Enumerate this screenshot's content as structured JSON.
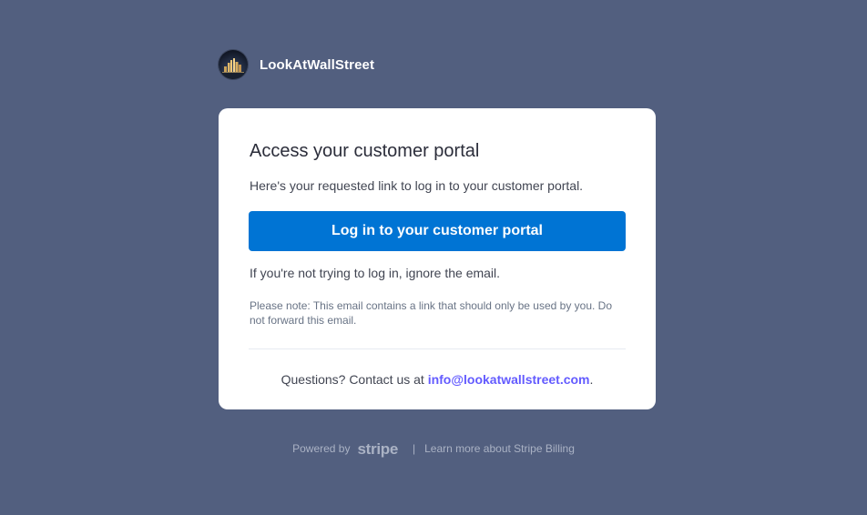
{
  "brand": {
    "name": "LookAtWallStreet",
    "avatar_icon": "city-skyline-icon"
  },
  "card": {
    "title": "Access your customer portal",
    "intro": "Here's your requested link to log in to your customer portal.",
    "login_button_label": "Log in to your customer portal",
    "ignore_text": "If you're not trying to log in, ignore the email.",
    "note": "Please note: This email contains a link that should only be used by you. Do not forward this email.",
    "contact_prefix": "Questions? Contact us at ",
    "contact_email": "info@lookatwallstreet.com",
    "contact_suffix": "."
  },
  "footer": {
    "powered_by": "Powered by",
    "stripe_logo": "stripe",
    "separator": "|",
    "learn_more": "Learn more about Stripe Billing"
  },
  "colors": {
    "background": "#525f7f",
    "button": "#0074d4",
    "link": "#635bff",
    "card": "#ffffff"
  }
}
